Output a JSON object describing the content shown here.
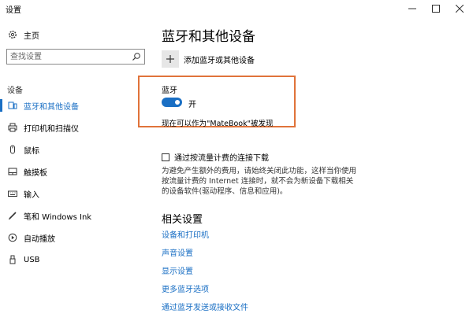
{
  "window": {
    "title": "设置"
  },
  "sidebar": {
    "home_label": "主页",
    "search_placeholder": "查找设置",
    "section_label": "设备",
    "items": [
      {
        "label": "蓝牙和其他设备",
        "icon": "bluetooth-devices-icon",
        "active": true
      },
      {
        "label": "打印机和扫描仪",
        "icon": "printer-icon",
        "active": false
      },
      {
        "label": "鼠标",
        "icon": "mouse-icon",
        "active": false
      },
      {
        "label": "触摸板",
        "icon": "touchpad-icon",
        "active": false
      },
      {
        "label": "输入",
        "icon": "keyboard-icon",
        "active": false
      },
      {
        "label": "笔和 Windows Ink",
        "icon": "pen-icon",
        "active": false
      },
      {
        "label": "自动播放",
        "icon": "autoplay-icon",
        "active": false
      },
      {
        "label": "USB",
        "icon": "usb-icon",
        "active": false
      }
    ]
  },
  "main": {
    "title": "蓝牙和其他设备",
    "add_device_label": "添加蓝牙或其他设备",
    "bluetooth_label": "蓝牙",
    "bluetooth_state": "开",
    "discoverable_text": "现在可以作为\"MateBook\"被发现",
    "metered_label": "通过按流量计费的连接下载",
    "metered_description": "为避免产生额外的费用，请始终关闭此功能，这样当你使用按流量计费的 Internet 连接时，就不会为新设备下载相关的设备软件(驱动程序、信息和应用)。",
    "related_title": "相关设置",
    "related_links": [
      "设备和打印机",
      "声音设置",
      "显示设置",
      "更多蓝牙选项",
      "通过蓝牙发送或接收文件"
    ]
  },
  "colors": {
    "accent": "#1a6fc4",
    "highlight": "#e0733a",
    "add_box": "#e6e6e6"
  }
}
